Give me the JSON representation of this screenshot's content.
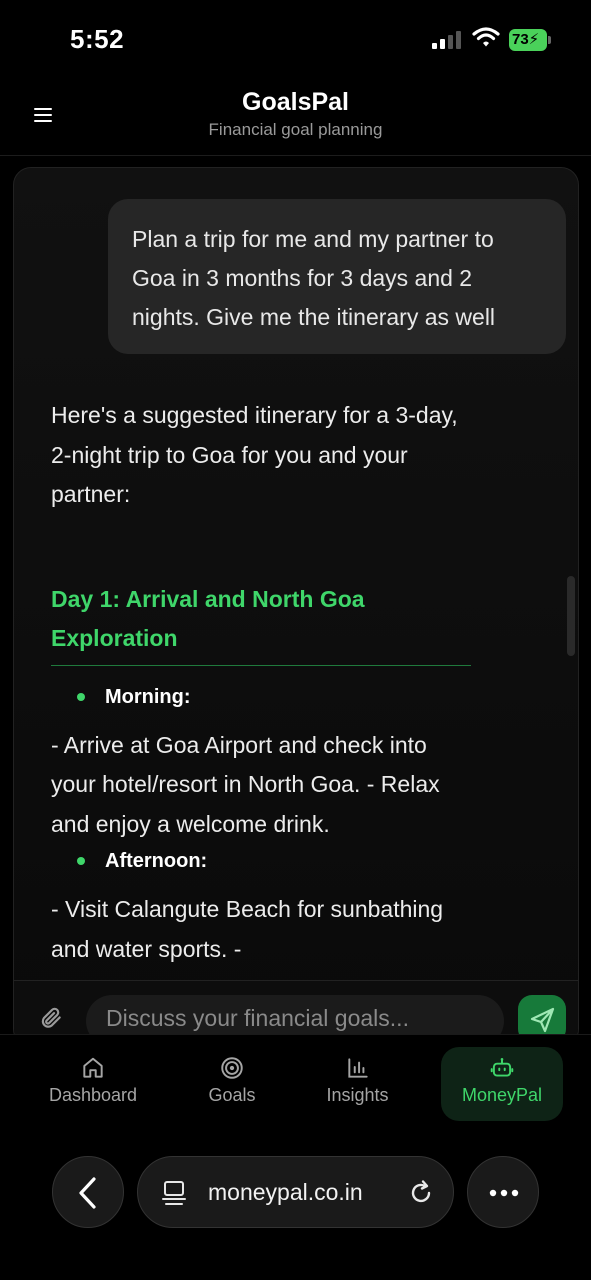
{
  "status_bar": {
    "time": "5:52",
    "battery": "73",
    "battery_color": "#4ad15a"
  },
  "header": {
    "title": "GoalsPal",
    "subtitle": "Financial goal planning"
  },
  "chat": {
    "user_message": "Plan a trip for me and my partner to Goa in 3 months for 3 days and 2 nights. Give me the itinerary as well",
    "assistant": {
      "intro": "Here's a suggested itinerary for a 3-day, 2-night trip to Goa for you and your partner:",
      "day1_heading": "Day 1: Arrival and North Goa Exploration",
      "sections": [
        {
          "label": "Morning:",
          "detail": "- Arrive at Goa Airport and check into your hotel/resort in North Goa. - Relax and enjoy a welcome drink."
        },
        {
          "label": "Afternoon:",
          "detail": "- Visit Calangute Beach for sunbathing and water sports. -"
        }
      ]
    },
    "input_placeholder": "Discuss your financial goals..."
  },
  "nav": {
    "items": [
      {
        "label": "Dashboard",
        "icon": "home-icon"
      },
      {
        "label": "Goals",
        "icon": "target-icon"
      },
      {
        "label": "Insights",
        "icon": "bar-chart-icon"
      },
      {
        "label": "MoneyPal",
        "icon": "bot-icon"
      }
    ],
    "active": "MoneyPal",
    "accent_color": "#3fd66a"
  },
  "browser": {
    "url": "moneypal.co.in"
  }
}
